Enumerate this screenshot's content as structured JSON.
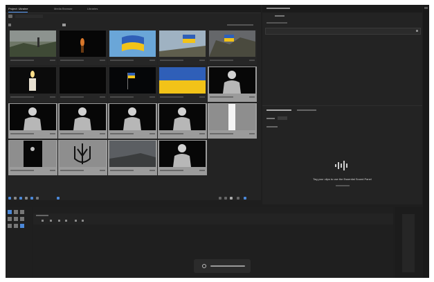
{
  "project_panel": {
    "tabs": [
      "Project: Ukraine",
      "Media Browser",
      "Libraries"
    ],
    "active_tab": 0
  },
  "clips": [
    {
      "id": "c1",
      "thumb": "landscape",
      "selected": false
    },
    {
      "id": "c2",
      "thumb": "candle-dark",
      "selected": false
    },
    {
      "id": "c3",
      "thumb": "flag-sky",
      "selected": false
    },
    {
      "id": "c4",
      "thumb": "flag-hill",
      "selected": false
    },
    {
      "id": "c5",
      "thumb": "flag-rocks",
      "selected": false
    },
    {
      "id": "c6",
      "thumb": "candle-glow",
      "selected": false
    },
    {
      "id": "c7",
      "thumb": "black",
      "selected": false
    },
    {
      "id": "c8",
      "thumb": "flag-night",
      "selected": false
    },
    {
      "id": "c9",
      "thumb": "flag-full",
      "selected": false
    },
    {
      "id": "c10",
      "thumb": "soldier",
      "selected": true
    },
    {
      "id": "c11",
      "thumb": "soldier",
      "selected": true
    },
    {
      "id": "c12",
      "thumb": "soldier",
      "selected": true
    },
    {
      "id": "c13",
      "thumb": "soldier",
      "selected": true
    },
    {
      "id": "c14",
      "thumb": "soldier",
      "selected": true
    },
    {
      "id": "c15",
      "thumb": "white-bar",
      "selected": true
    },
    {
      "id": "c16",
      "thumb": "figure-dark",
      "selected": true
    },
    {
      "id": "c17",
      "thumb": "trident",
      "selected": true
    },
    {
      "id": "c18",
      "thumb": "grey-sky",
      "selected": true
    },
    {
      "id": "c19",
      "thumb": "soldier",
      "selected": true
    }
  ],
  "essential_sound": {
    "message": "Tag your clips to use the Essential Sound Panel"
  },
  "colors": {
    "accent": "#5aa0ff",
    "selected_cell": "#9b9b9b",
    "flag_blue": "#2f5fb8",
    "flag_yellow": "#f2c318"
  }
}
